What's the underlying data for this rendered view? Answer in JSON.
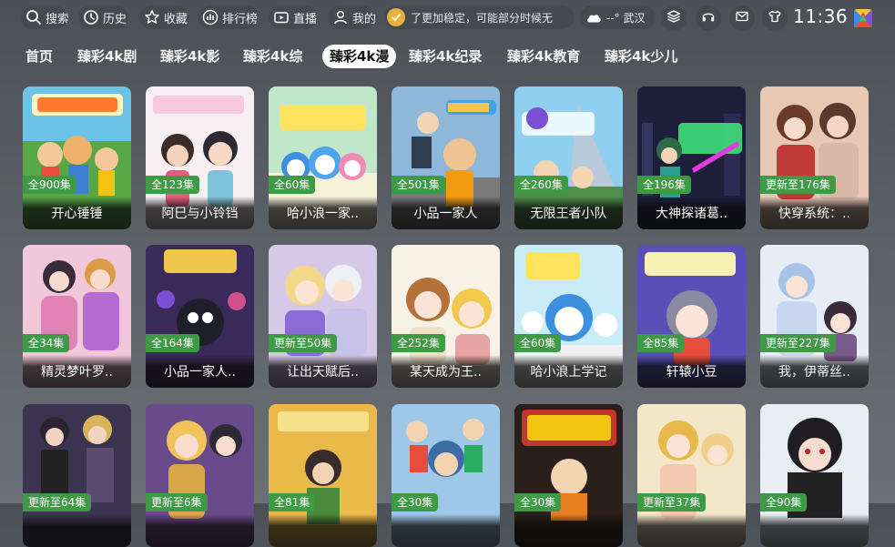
{
  "topbar": {
    "search_label": "搜索",
    "history_label": "历史",
    "favorites_label": "收藏",
    "ranking_label": "排行榜",
    "live_label": "直播",
    "mine_label": "我的",
    "notice_text": "了更加稳定，可能部分时候无",
    "weather_text": "--° 武汉",
    "time": "11:36",
    "icons": [
      "search-icon",
      "history-icon",
      "star-icon",
      "ranking-icon",
      "tv-icon",
      "user-icon",
      "coin-icon",
      "cloud-icon",
      "layers-icon",
      "headset-icon",
      "mail-icon",
      "tshirt-icon",
      "app-logo-icon"
    ]
  },
  "tabs": [
    {
      "label": "首页"
    },
    {
      "label": "臻彩4k剧"
    },
    {
      "label": "臻彩4k影"
    },
    {
      "label": "臻彩4k综"
    },
    {
      "label": "臻彩4k漫"
    },
    {
      "label": "臻彩4k纪录"
    },
    {
      "label": "臻彩4k教育"
    },
    {
      "label": "臻彩4k少儿"
    }
  ],
  "active_tab": "臻彩4k漫",
  "colors": {
    "badge": "#3f9a46",
    "active_tab_bg": "#ffffff"
  },
  "cards": [
    {
      "title": "开心锤锤",
      "badge": "全900集"
    },
    {
      "title": "阿巳与小铃铛",
      "badge": "全123集"
    },
    {
      "title": "哈小浪一家..",
      "badge": "全60集"
    },
    {
      "title": "小品一家人",
      "badge": "全501集"
    },
    {
      "title": "无限王者小队",
      "badge": "全260集"
    },
    {
      "title": "大神探诸葛..",
      "badge": "全196集"
    },
    {
      "title": "快穿系统：..",
      "badge": "更新至176集"
    },
    {
      "title": "精灵梦叶罗..",
      "badge": "全34集"
    },
    {
      "title": "小品一家人..",
      "badge": "全164集"
    },
    {
      "title": "让出天赋后..",
      "badge": "更新至50集"
    },
    {
      "title": "某天成为王..",
      "badge": "全252集"
    },
    {
      "title": "哈小浪上学记",
      "badge": "全60集"
    },
    {
      "title": "轩辕小豆",
      "badge": "全85集"
    },
    {
      "title": "我，伊蒂丝..",
      "badge": "更新至227集"
    },
    {
      "title": "",
      "badge": "更新至64集"
    },
    {
      "title": "",
      "badge": "更新至6集"
    },
    {
      "title": "",
      "badge": "全81集"
    },
    {
      "title": "",
      "badge": "全30集"
    },
    {
      "title": "",
      "badge": "全30集"
    },
    {
      "title": "",
      "badge": "更新至37集"
    },
    {
      "title": "",
      "badge": "全90集"
    }
  ]
}
